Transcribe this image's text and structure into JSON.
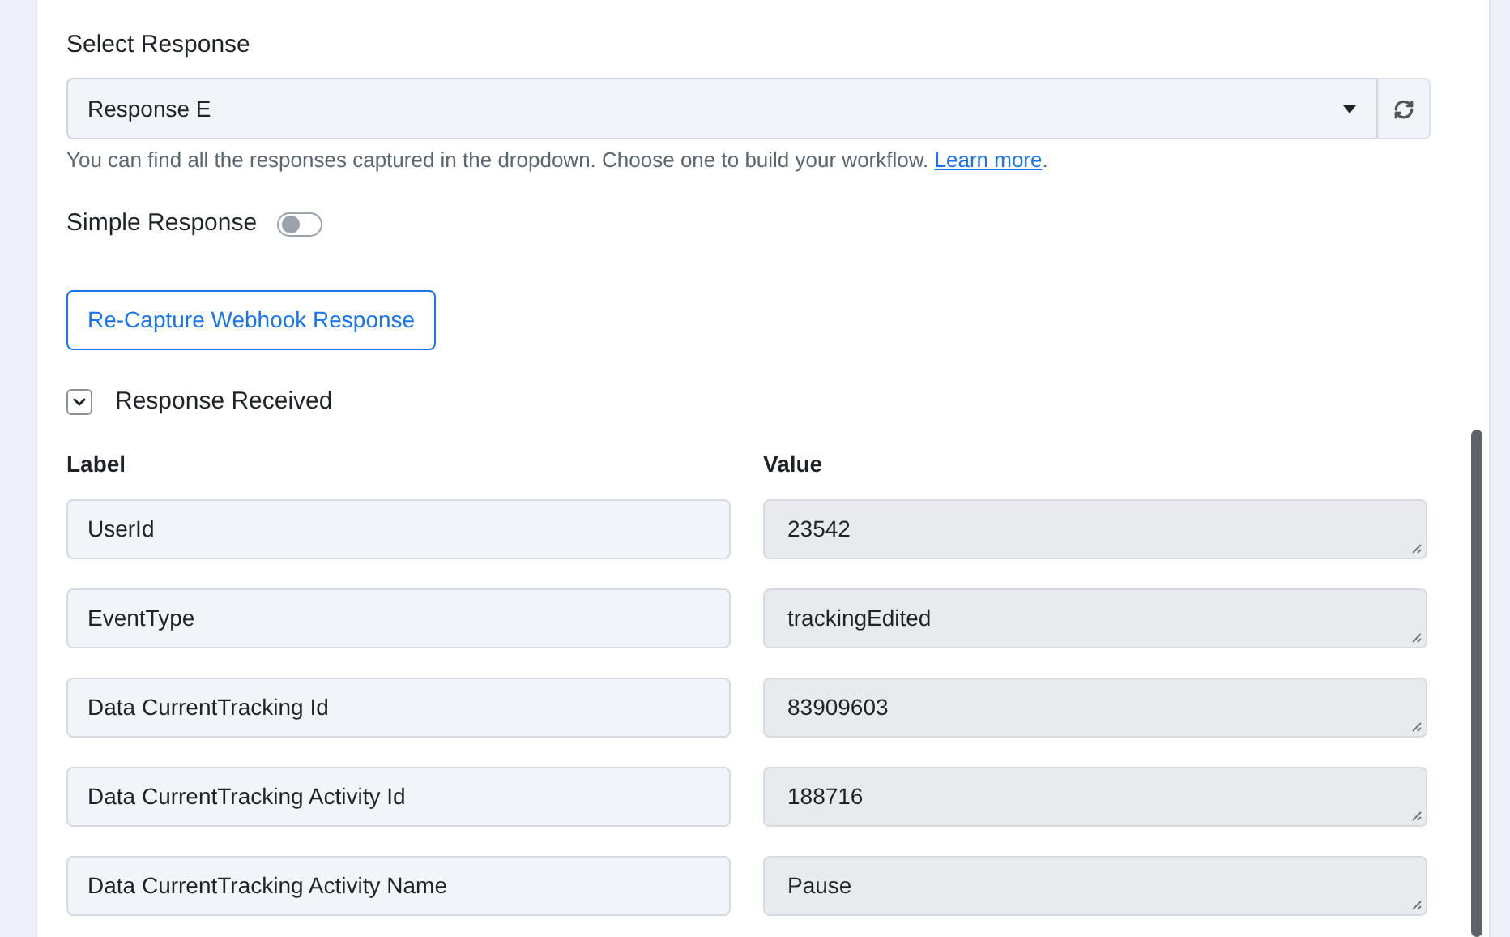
{
  "select_response": {
    "label": "Select Response",
    "value": "Response E",
    "help": "You can find all the responses captured in the dropdown. Choose one to build your workflow. ",
    "help_link": "Learn more",
    "help_end": "."
  },
  "simple_response": {
    "label": "Simple Response",
    "on": false
  },
  "recapture_button": "Re-Capture Webhook Response",
  "response_received": {
    "label": "Response Received",
    "expanded": true
  },
  "table": {
    "columns": [
      "Label",
      "Value"
    ],
    "rows": [
      {
        "label": "UserId",
        "value": "23542"
      },
      {
        "label": "EventType",
        "value": "trackingEdited"
      },
      {
        "label": "Data CurrentTracking Id",
        "value": "83909603"
      },
      {
        "label": "Data CurrentTracking Activity Id",
        "value": "188716"
      },
      {
        "label": "Data CurrentTracking Activity Name",
        "value": "Pause"
      }
    ]
  }
}
